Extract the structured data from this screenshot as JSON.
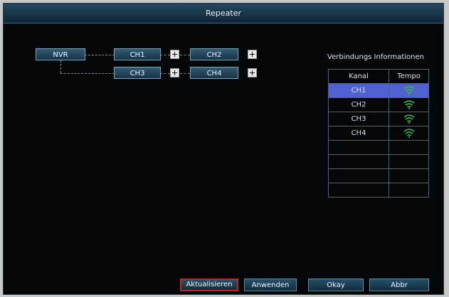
{
  "window": {
    "title": "Repeater"
  },
  "topology": {
    "nvr": "NVR",
    "channels": [
      "CH1",
      "CH2",
      "CH3",
      "CH4"
    ]
  },
  "info": {
    "title": "Verbindungs Informationen",
    "headers": [
      "Kanal",
      "Tempo"
    ],
    "rows": [
      {
        "channel": "CH1",
        "signal": "wifi-icon",
        "selected": true
      },
      {
        "channel": "CH2",
        "signal": "wifi-icon",
        "selected": false
      },
      {
        "channel": "CH3",
        "signal": "wifi-icon",
        "selected": false
      },
      {
        "channel": "CH4",
        "signal": "wifi-icon",
        "selected": false
      },
      {
        "channel": "",
        "signal": "",
        "selected": false
      },
      {
        "channel": "",
        "signal": "",
        "selected": false
      },
      {
        "channel": "",
        "signal": "",
        "selected": false
      },
      {
        "channel": "",
        "signal": "",
        "selected": false
      }
    ]
  },
  "buttons": {
    "refresh": "Aktualisieren",
    "apply": "Anwenden",
    "ok": "Okay",
    "cancel": "Abbr"
  },
  "colors": {
    "accent_green": "#42b84a",
    "selected_row": "#4f62cf",
    "focus_outline": "#d01d1d"
  }
}
